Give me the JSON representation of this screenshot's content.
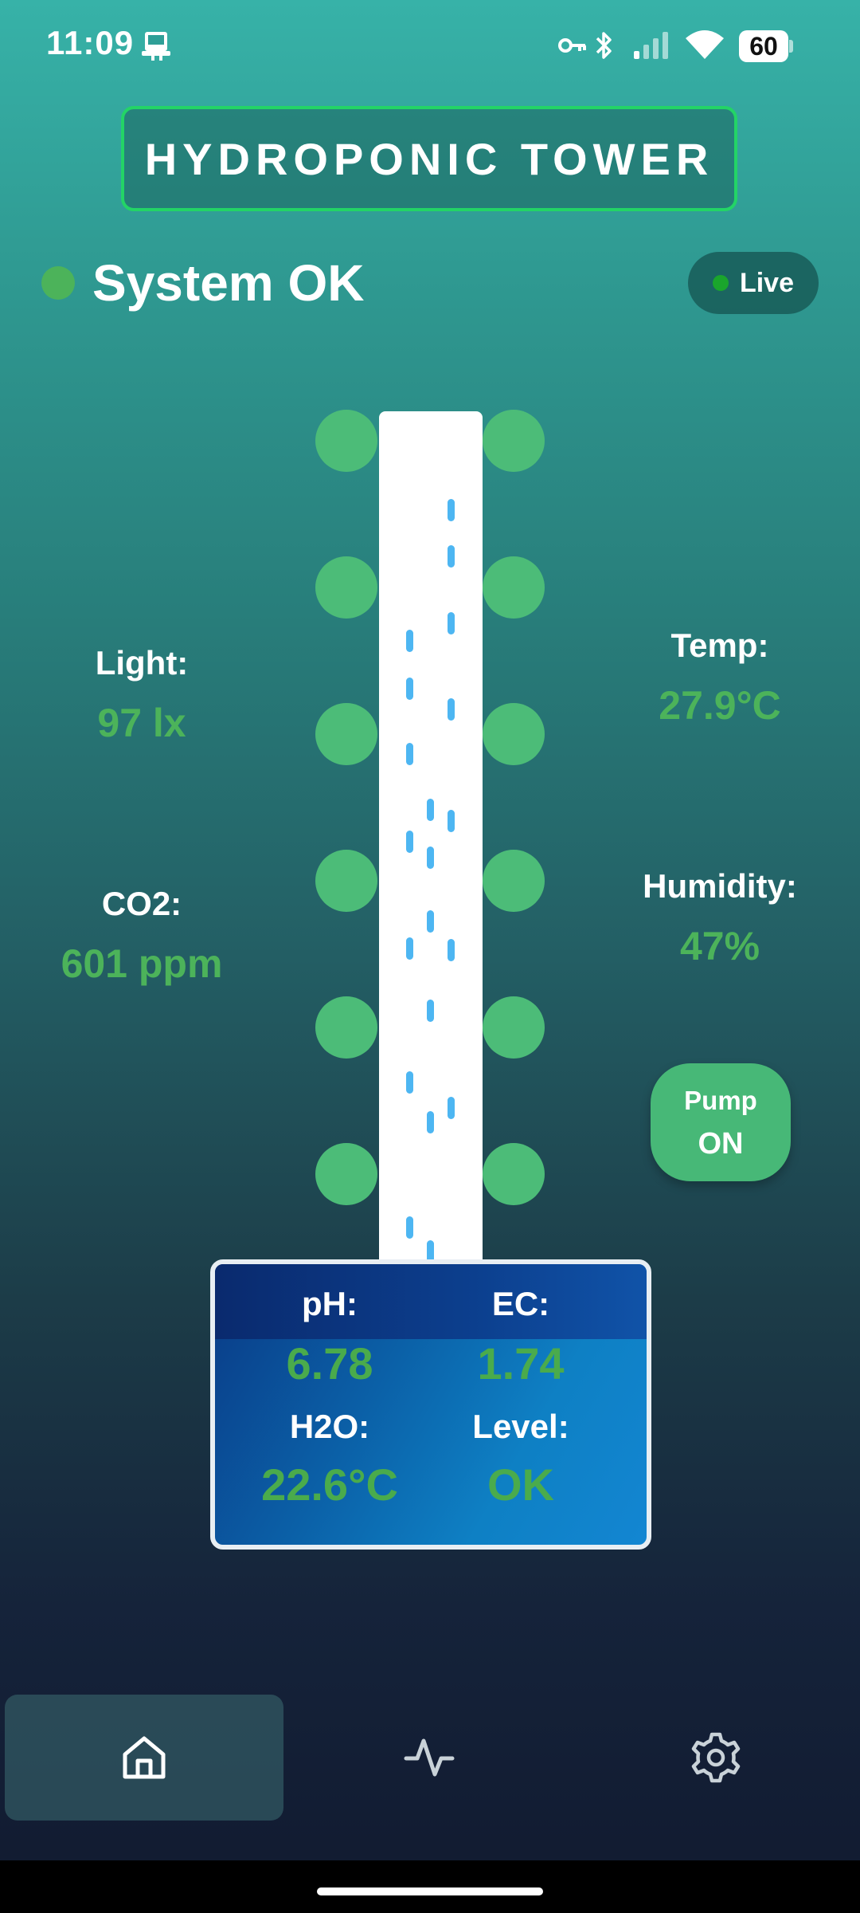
{
  "status_bar": {
    "time": "11:09",
    "battery": "60",
    "icons": [
      "phone-device-icon",
      "key-icon",
      "bluetooth-icon",
      "signal-icon",
      "wifi-icon",
      "battery-icon"
    ]
  },
  "header": {
    "title": "HYDROPONIC TOWER"
  },
  "system": {
    "status": "System OK",
    "live_label": "Live",
    "status_color": "#4cb35a"
  },
  "metrics": {
    "light": {
      "label": "Light:",
      "value": "97 lx"
    },
    "co2": {
      "label": "CO2:",
      "value": "601 ppm"
    },
    "temp": {
      "label": "Temp:",
      "value": "27.9°C"
    },
    "humidity": {
      "label": "Humidity:",
      "value": "47%"
    }
  },
  "pump": {
    "label": "Pump",
    "state": "ON"
  },
  "water": {
    "ph": {
      "label": "pH:",
      "value": "6.78"
    },
    "ec": {
      "label": "EC:",
      "value": "1.74"
    },
    "h2o": {
      "label": "H2O:",
      "value": "22.6°C"
    },
    "level": {
      "label": "Level:",
      "value": "OK"
    }
  },
  "nav": {
    "items": [
      {
        "name": "home",
        "icon": "home-icon",
        "active": true
      },
      {
        "name": "activity",
        "icon": "activity-icon",
        "active": false
      },
      {
        "name": "settings",
        "icon": "gear-icon",
        "active": false
      }
    ]
  },
  "colors": {
    "accent_green": "#4cb35a",
    "title_border": "#23d466",
    "pod_green": "#4cbc78",
    "drop_blue": "#4db6f2"
  }
}
